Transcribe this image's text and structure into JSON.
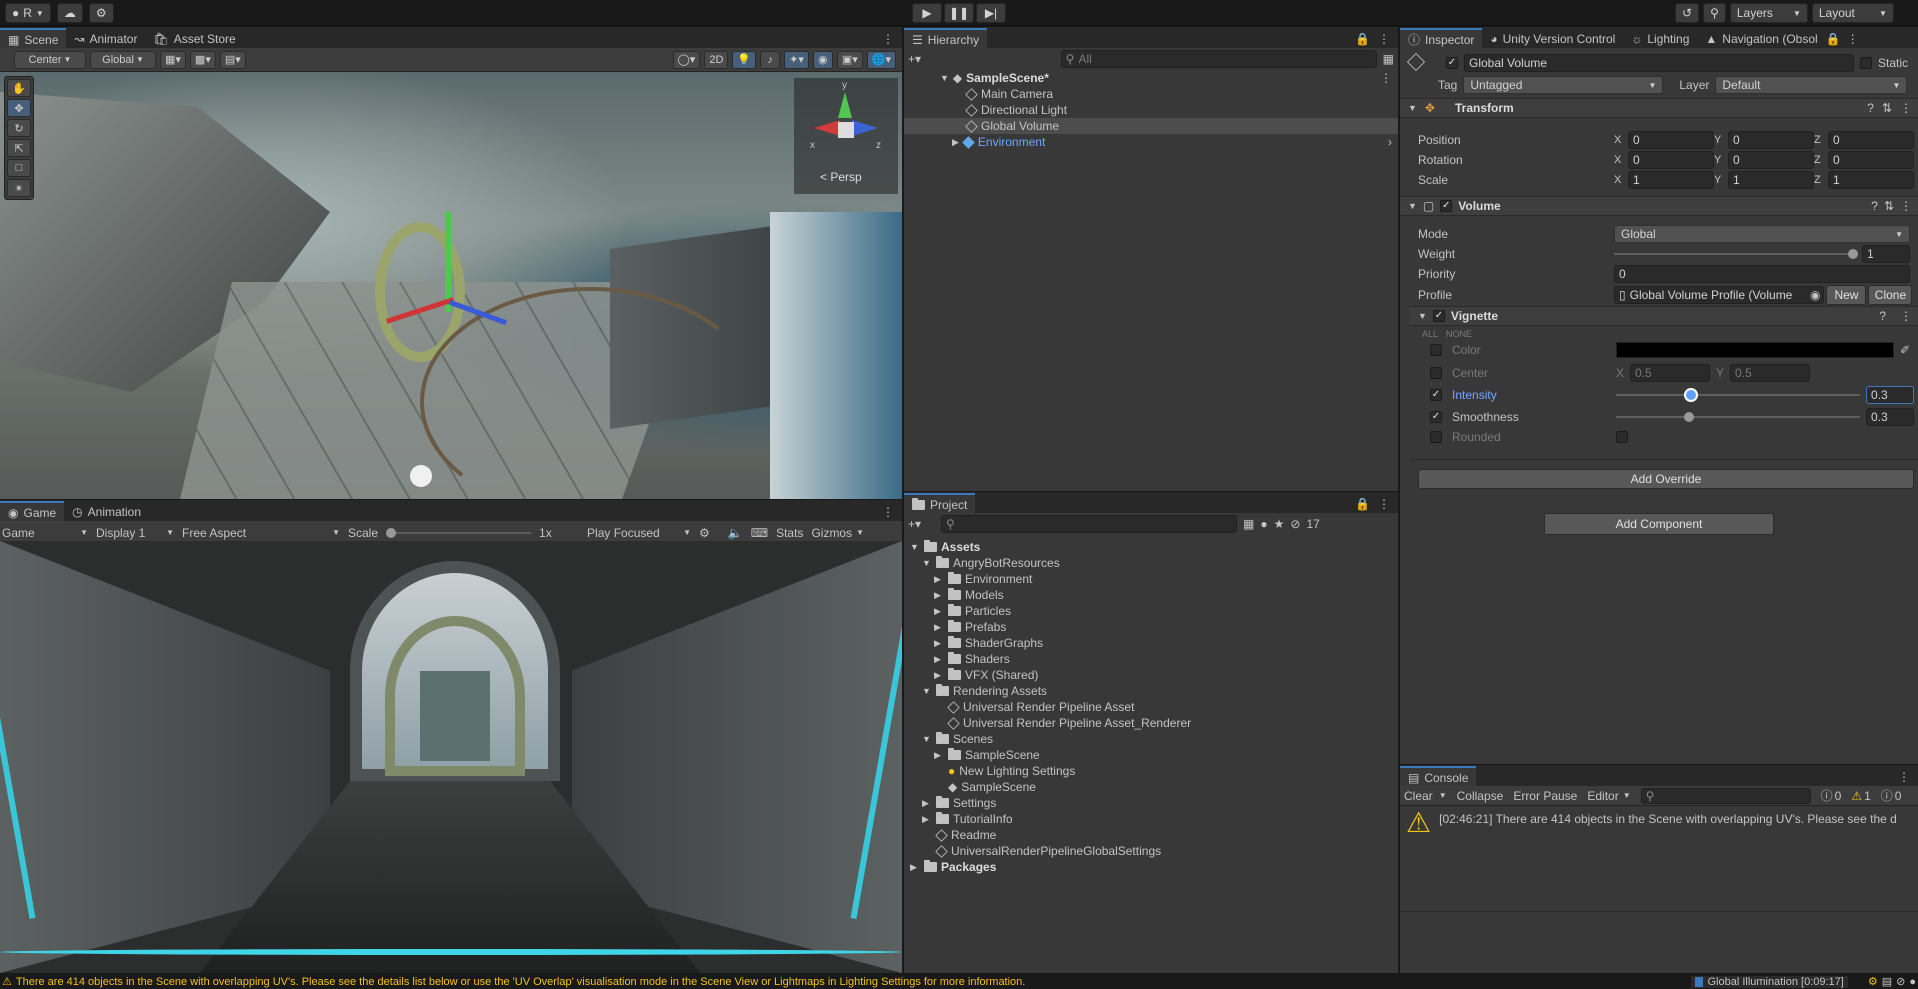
{
  "topbar": {
    "account_label": "R",
    "layers_label": "Layers",
    "layout_label": "Layout"
  },
  "scene_tabs": [
    "Scene",
    "Animator",
    "Asset Store"
  ],
  "scene_toolbar": {
    "pivot": "Center",
    "space": "Global",
    "mode_2d": "2D"
  },
  "scene_view": {
    "persp_label": "Persp",
    "gizmo_axes": {
      "x": "x",
      "y": "y",
      "z": "z"
    }
  },
  "game_tabs": [
    "Game",
    "Animation"
  ],
  "game_toolbar": {
    "mode": "Game",
    "display": "Display 1",
    "aspect": "Free Aspect",
    "scale_label": "Scale",
    "scale_value": "1x",
    "play_mode": "Play Focused",
    "stats": "Stats",
    "gizmos": "Gizmos"
  },
  "hierarchy": {
    "tab": "Hierarchy",
    "search_placeholder": "All",
    "scene": "SampleScene*",
    "items": [
      "Main Camera",
      "Directional Light",
      "Global Volume",
      "Environment"
    ]
  },
  "project": {
    "tab": "Project",
    "hidden_count": "17",
    "tree": [
      {
        "label": "Assets",
        "depth": 0,
        "type": "folder",
        "open": true,
        "bold": true
      },
      {
        "label": "AngryBotResources",
        "depth": 1,
        "type": "folder",
        "open": true
      },
      {
        "label": "Environment",
        "depth": 2,
        "type": "folder"
      },
      {
        "label": "Models",
        "depth": 2,
        "type": "folder"
      },
      {
        "label": "Particles",
        "depth": 2,
        "type": "folder"
      },
      {
        "label": "Prefabs",
        "depth": 2,
        "type": "folder"
      },
      {
        "label": "ShaderGraphs",
        "depth": 2,
        "type": "folder"
      },
      {
        "label": "Shaders",
        "depth": 2,
        "type": "folder"
      },
      {
        "label": "VFX (Shared)",
        "depth": 2,
        "type": "folder"
      },
      {
        "label": "Rendering Assets",
        "depth": 1,
        "type": "folder",
        "open": true
      },
      {
        "label": "Universal Render Pipeline Asset",
        "depth": 2,
        "type": "asset"
      },
      {
        "label": "Universal Render Pipeline Asset_Renderer",
        "depth": 2,
        "type": "asset"
      },
      {
        "label": "Scenes",
        "depth": 1,
        "type": "folder",
        "open": true
      },
      {
        "label": "SampleScene",
        "depth": 2,
        "type": "folder"
      },
      {
        "label": "New Lighting Settings",
        "depth": 2,
        "type": "light"
      },
      {
        "label": "SampleScene",
        "depth": 2,
        "type": "scene"
      },
      {
        "label": "Settings",
        "depth": 1,
        "type": "folder"
      },
      {
        "label": "TutorialInfo",
        "depth": 1,
        "type": "folder"
      },
      {
        "label": "Readme",
        "depth": 1,
        "type": "asset"
      },
      {
        "label": "UniversalRenderPipelineGlobalSettings",
        "depth": 1,
        "type": "asset"
      },
      {
        "label": "Packages",
        "depth": 0,
        "type": "folder",
        "bold": true
      }
    ]
  },
  "inspector": {
    "tabs": [
      "Inspector",
      "Unity Version Control",
      "Lighting",
      "Navigation (Obsol"
    ],
    "object_name": "Global Volume",
    "static_label": "Static",
    "tag_label": "Tag",
    "tag_value": "Untagged",
    "layer_label": "Layer",
    "layer_value": "Default",
    "transform": {
      "title": "Transform",
      "rows": [
        {
          "label": "Position",
          "x": "0",
          "y": "0",
          "z": "0"
        },
        {
          "label": "Rotation",
          "x": "0",
          "y": "0",
          "z": "0"
        },
        {
          "label": "Scale",
          "x": "1",
          "y": "1",
          "z": "1"
        }
      ]
    },
    "volume": {
      "title": "Volume",
      "mode_label": "Mode",
      "mode_value": "Global",
      "weight_label": "Weight",
      "weight_value": "1",
      "priority_label": "Priority",
      "priority_value": "0",
      "profile_label": "Profile",
      "profile_value": "Global Volume Profile (Volume",
      "new_label": "New",
      "clone_label": "Clone"
    },
    "vignette": {
      "title": "Vignette",
      "all": "ALL",
      "none": "NONE",
      "color_label": "Color",
      "center_label": "Center",
      "center_x": "0.5",
      "center_y": "0.5",
      "intensity_label": "Intensity",
      "intensity_value": "0.3",
      "smoothness_label": "Smoothness",
      "smoothness_value": "0.3",
      "rounded_label": "Rounded"
    },
    "add_override": "Add Override",
    "add_component": "Add Component"
  },
  "console": {
    "tab": "Console",
    "clear": "Clear",
    "collapse": "Collapse",
    "error_pause": "Error Pause",
    "editor": "Editor",
    "count_log": "0",
    "count_warn": "1",
    "count_err": "0",
    "message": "[02:46:21] There are 414 objects in the Scene with overlapping UV's. Please see the d"
  },
  "statusbar": {
    "message": "There are 414 objects in the Scene with overlapping UV's. Please see the details list below or use the 'UV Overlap' visualisation mode in the Scene View or Lightmaps in Lighting Settings for more information.",
    "gi": "Global Illumination [0:09:17]"
  },
  "colors": {
    "accent": "#3a79bb",
    "warning": "#f4c21b",
    "selected_text": "#6fa8ff"
  }
}
